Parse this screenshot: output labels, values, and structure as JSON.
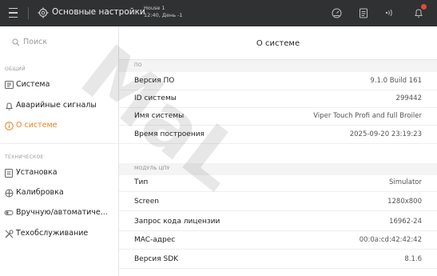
{
  "topbar": {
    "title": "Основные настройки",
    "house_name": "House 1",
    "house_sub": "12:40, День -1"
  },
  "sidebar": {
    "search_placeholder": "Поиск",
    "section_general": "ОБЩИЙ",
    "section_technical": "ТЕХНИЧЕСКОЕ",
    "general_items": [
      {
        "label": "Система",
        "icon": "system-icon"
      },
      {
        "label": "Аварийные сигналы",
        "icon": "alarm-icon"
      },
      {
        "label": "О системе",
        "icon": "info-icon"
      }
    ],
    "technical_items": [
      {
        "label": "Установка",
        "icon": "install-icon"
      },
      {
        "label": "Калибровка",
        "icon": "calibration-icon"
      },
      {
        "label": "Вручную/автоматиче...",
        "icon": "manual-auto-icon"
      },
      {
        "label": "Техобслуживание",
        "icon": "maintenance-icon"
      }
    ]
  },
  "main": {
    "title": "О системе",
    "group_software": "ПО",
    "group_cpu": "МОДУЛЬ ЦПУ",
    "software_rows": [
      {
        "label": "Версия ПО",
        "value": "9.1.0 Build 161"
      },
      {
        "label": "ID системы",
        "value": "299442"
      },
      {
        "label": "Имя системы",
        "value": "Viper Touch Profi and full Broiler"
      },
      {
        "label": "Время построения",
        "value": "2025-09-20 23:19:23"
      }
    ],
    "cpu_rows": [
      {
        "label": "Тип",
        "value": "Simulator"
      },
      {
        "label": "Screen",
        "value": "1280x800"
      },
      {
        "label": "Запрос кода лицензии",
        "value": "16962-24"
      },
      {
        "label": "MAC-адрес",
        "value": "00:0a:cd:42:42:42"
      },
      {
        "label": "Версия SDK",
        "value": "8.1.6"
      }
    ]
  },
  "colors": {
    "topbar": "#2f3133",
    "accent": "#e0851d",
    "badge": "#e24a3b"
  },
  "watermark": "MaL"
}
